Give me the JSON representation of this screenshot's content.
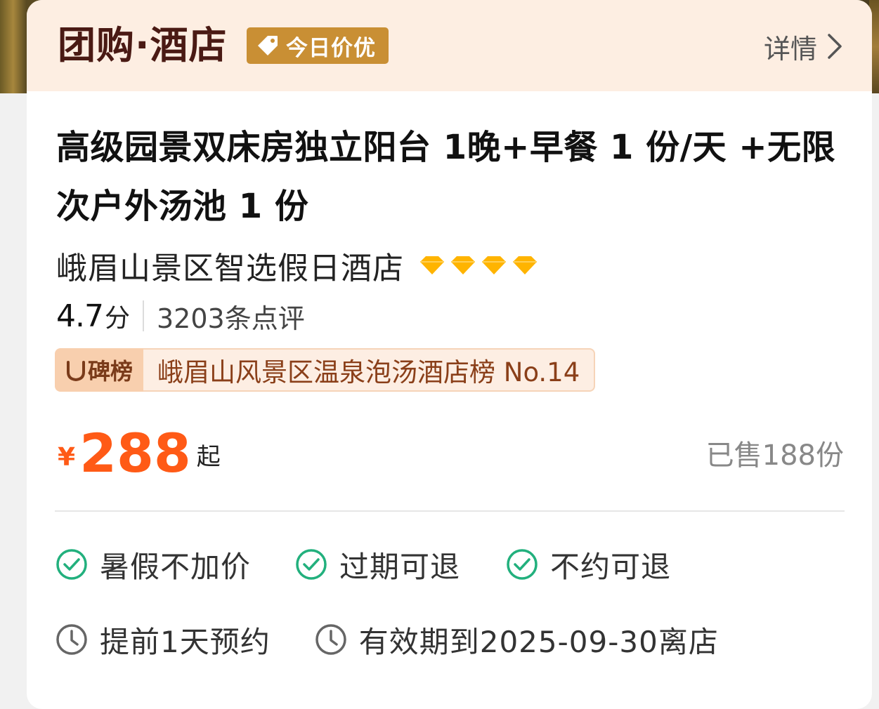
{
  "header": {
    "logo_text": "团购·酒店",
    "badge_label": "今日价优",
    "details_label": "详情"
  },
  "product": {
    "title": "高级园景双床房独立阳台 1晚+早餐 1 份/天 +无限次户外汤池 1 份",
    "hotel_name": "峨眉山景区智选假日酒店",
    "star_level": 4,
    "score": "4.7",
    "score_unit": "分",
    "review_count": "3203条点评",
    "rank_brand": "碑榜",
    "rank_text": "峨眉山风景区温泉泡汤酒店榜 No.14"
  },
  "pricing": {
    "currency": "¥",
    "price": "288",
    "suffix": "起",
    "sold": "已售188份"
  },
  "features": {
    "row1": [
      "暑假不加价",
      "过期可退",
      "不约可退"
    ],
    "row2": [
      "提前1天预约",
      "有效期到2025-09-30离店"
    ]
  },
  "colors": {
    "accent": "#ff5a16",
    "check": "#22b07d",
    "badge": "#c98f34",
    "diamond": "#ffb400"
  },
  "icons": {
    "badge": "tag-icon",
    "details": "chevron-right-icon",
    "star": "diamond-icon",
    "row1": "check-circle-icon",
    "row2": "clock-icon"
  }
}
